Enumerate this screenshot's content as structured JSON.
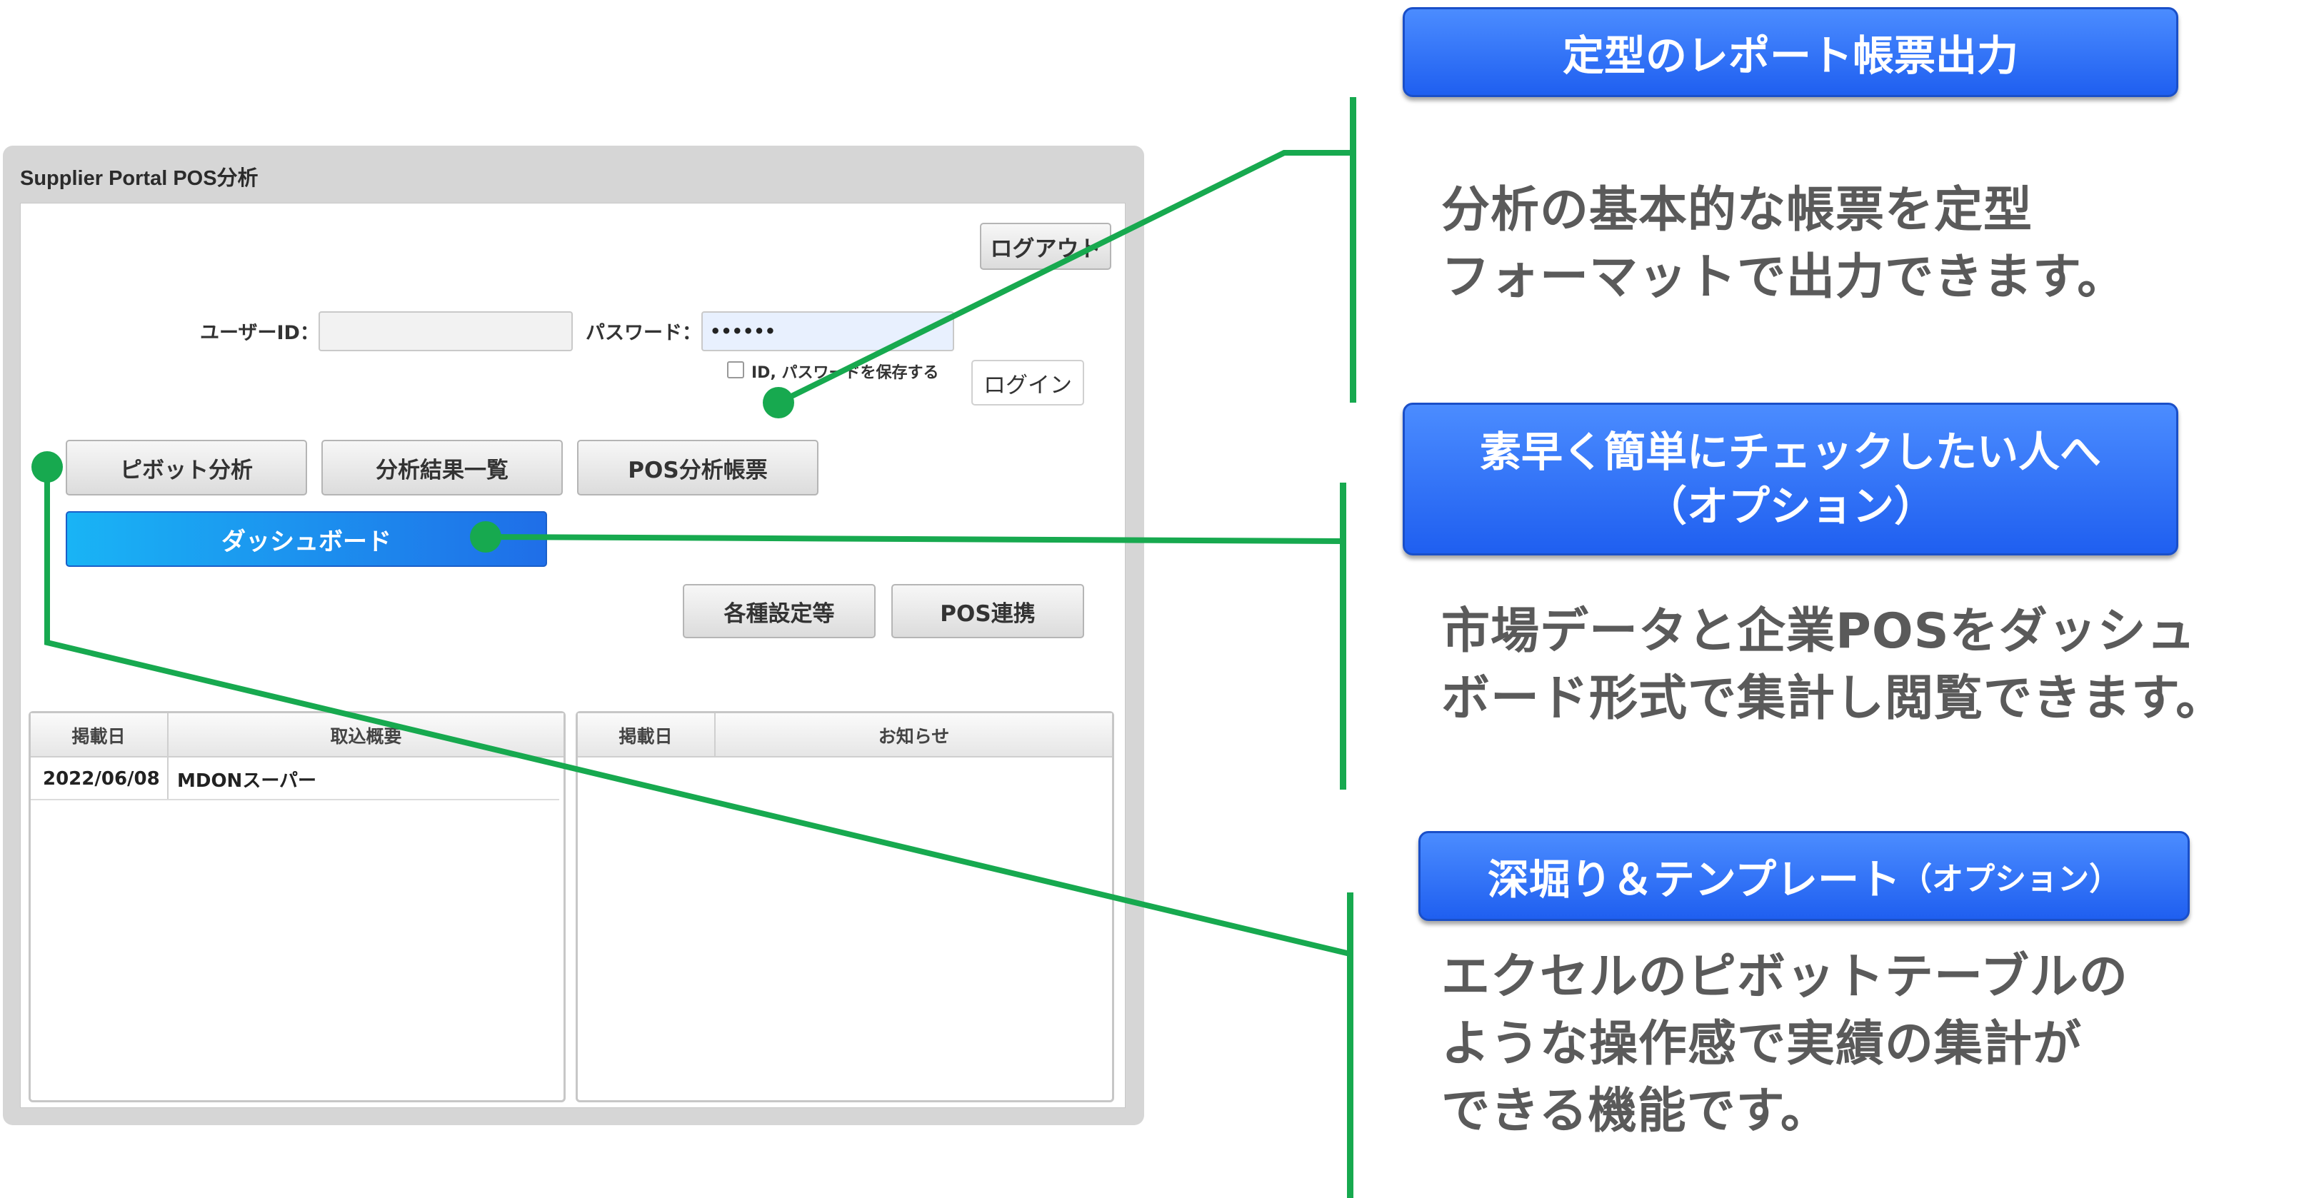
{
  "window": {
    "title": "Supplier Portal POS分析"
  },
  "login": {
    "logout_label": "ログアウト",
    "user_id_label": "ユーザーID：",
    "user_id_value": "",
    "password_label": "パスワード：",
    "password_value": "••••••",
    "save_checkbox_label": "ID, パスワードを保存する",
    "save_checked": false,
    "login_label": "ログイン"
  },
  "menu": {
    "pivot_label": "ピボット分析",
    "results_label": "分析結果一覧",
    "pos_report_label": "POS分析帳票",
    "dashboard_label": "ダッシュボード",
    "settings_label": "各種設定等",
    "pos_link_label": "POS連携"
  },
  "tables": {
    "left": {
      "headers": [
        "掲載日",
        "取込概要"
      ],
      "rows": [
        [
          "2022/06/08",
          "MDONスーパー"
        ]
      ]
    },
    "right": {
      "headers": [
        "掲載日",
        "お知らせ"
      ],
      "rows": []
    }
  },
  "callouts": [
    {
      "tag_line1": "定型のレポート帳票出力",
      "tag_line2": "",
      "desc_lines": [
        "分析の基本的な帳票を定型",
        "フォーマットで出力できます。"
      ]
    },
    {
      "tag_line1": "素早く簡単にチェックしたい人へ",
      "tag_line2": "（オプション）",
      "desc_lines": [
        "市場データと企業POSをダッシュ",
        "ボード形式で集計し閲覧できます。"
      ]
    },
    {
      "tag_line1": "深堀り＆テンプレート",
      "tag_line1_suffix": "（オプション）",
      "desc_lines": [
        "エクセルのピボットテーブルの",
        "ような操作感で実績の集計が",
        "できる機能です。"
      ]
    }
  ],
  "colors": {
    "accent_green": "#17a94f",
    "tag_blue": "#2a6ff5",
    "dashboard_blue": "#19b4f5"
  }
}
